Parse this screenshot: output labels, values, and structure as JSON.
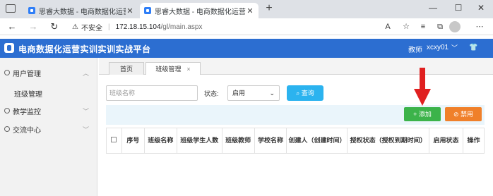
{
  "browser": {
    "tabs": [
      {
        "title": "思睿大数据 - 电商数据化运营实..."
      },
      {
        "title": "思睿大数据 - 电商数据化运营实..."
      }
    ],
    "not_secure": "不安全",
    "host": "172.18.15.104",
    "path": "/gl/main.aspx"
  },
  "app": {
    "title": "电商数据化运营实训实训实战平台",
    "role": "教师",
    "username": "xcxy01",
    "accent": "#2c6ed1"
  },
  "sidebar": {
    "items": [
      {
        "label": "用户管理",
        "icon": "user-icon",
        "sub": [
          "班级管理"
        ]
      },
      {
        "label": "教学监控",
        "icon": "monitor-icon"
      },
      {
        "label": "交流中心",
        "icon": "chat-icon"
      }
    ]
  },
  "page_tabs": [
    {
      "label": "首页"
    },
    {
      "label": "班级管理",
      "close": "×"
    }
  ],
  "filter": {
    "placeholder": "班级名称",
    "status_label": "状态:",
    "status_value": "启用",
    "search_label": "查询"
  },
  "actions": {
    "add_label": "添加",
    "disable_label": "禁用"
  },
  "table": {
    "headers": [
      "",
      "序号",
      "班级名称",
      "班级学生人数",
      "班级教师",
      "学校名称",
      "创建人（创建时间）",
      "授权状态（授权到期时间）",
      "启用状态",
      "操作"
    ]
  }
}
